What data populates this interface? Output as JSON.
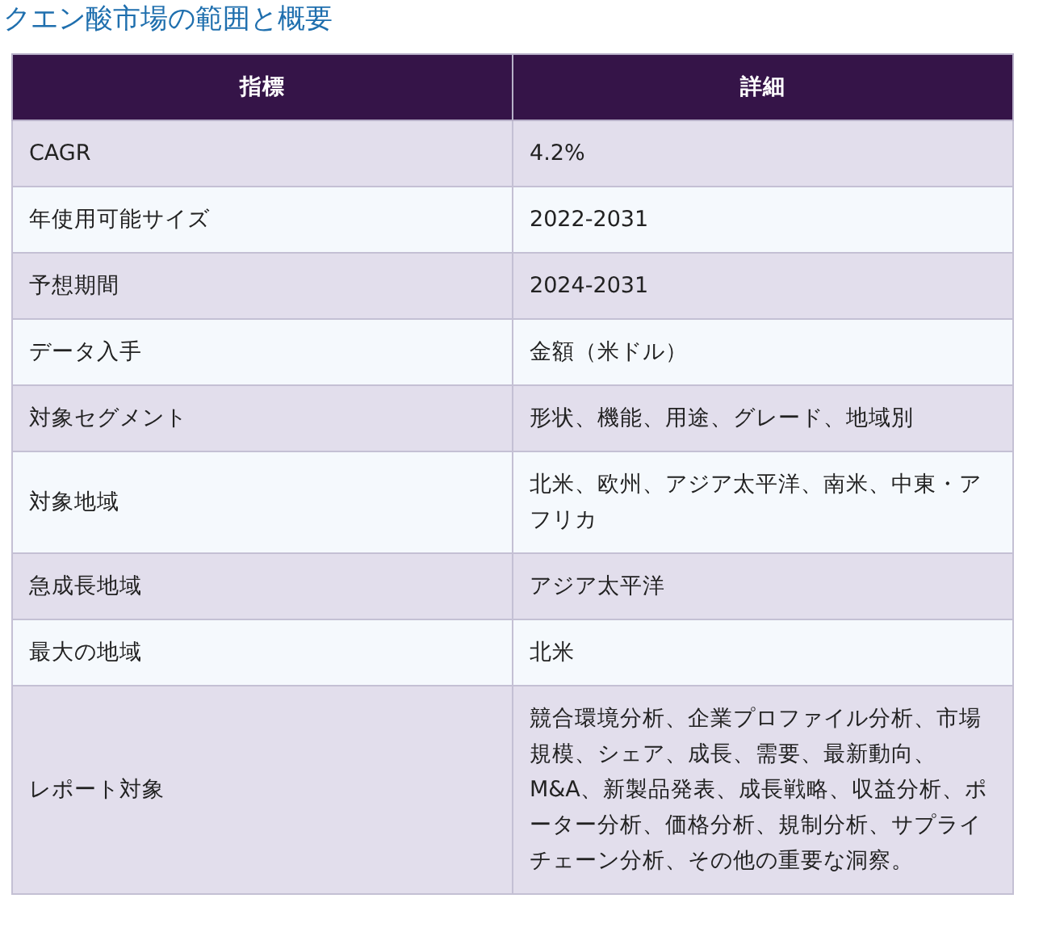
{
  "title": "クエン酸市場の範囲と概要",
  "table": {
    "columns": [
      "指標",
      "詳細"
    ],
    "rows": [
      {
        "cells": [
          "CAGR",
          "4.2%"
        ]
      },
      {
        "cells": [
          "年使用可能サイズ",
          "2022-2031"
        ]
      },
      {
        "cells": [
          "予想期間",
          "2024-2031"
        ]
      },
      {
        "cells": [
          "データ入手",
          "金額（米ドル）"
        ]
      },
      {
        "cells": [
          "対象セグメント",
          "形状、機能、用途、グレード、地域別"
        ]
      },
      {
        "cells": [
          "対象地域",
          "北米、欧州、アジア太平洋、南米、中東・アフリカ"
        ]
      },
      {
        "cells": [
          "急成長地域",
          "アジア太平洋"
        ]
      },
      {
        "cells": [
          "最大の地域",
          "北米"
        ]
      },
      {
        "cells": [
          "レポート対象",
          "競合環境分析、企業プロファイル分析、市場規模、シェア、成長、需要、最新動向、M&A、新製品発表、成長戦略、収益分析、ポーター分析、価格分析、規制分析、サプライチェーン分析、その他の重要な洞察。"
        ]
      }
    ]
  }
}
